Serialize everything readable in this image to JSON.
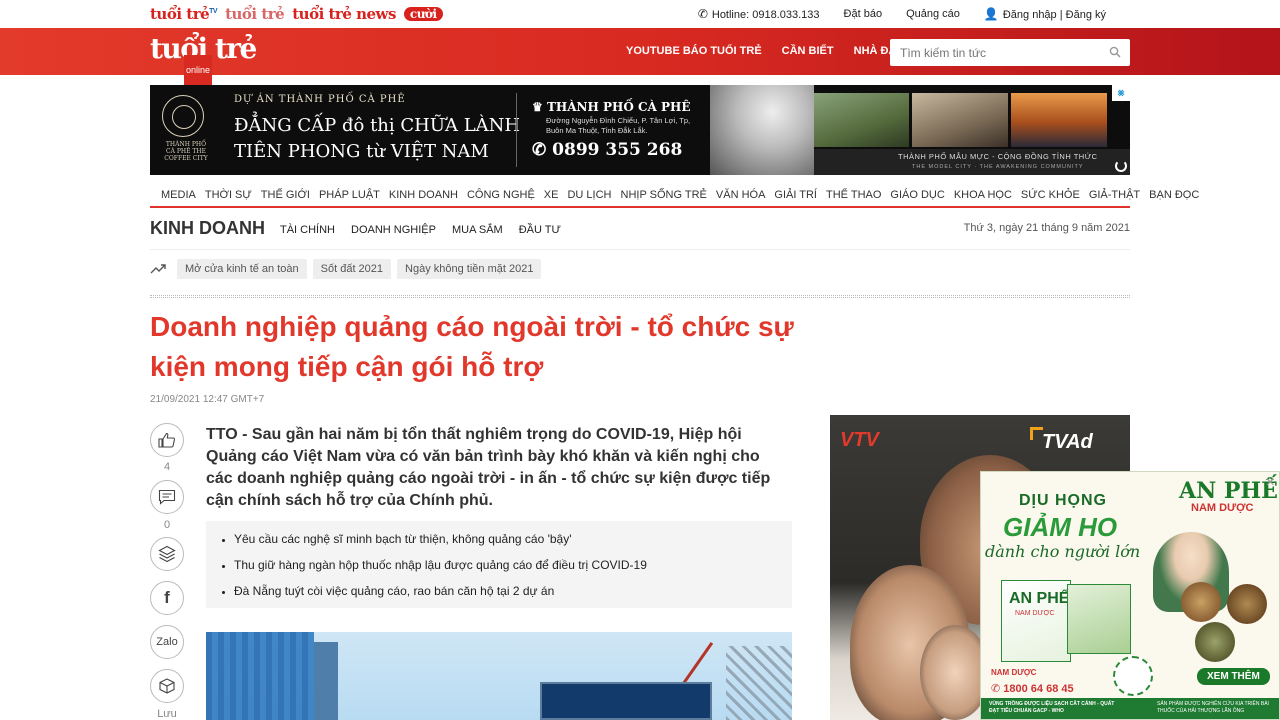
{
  "topbar": {
    "brands": [
      "tuổi trẻ",
      "TV",
      "tuổi trẻ",
      "tuổi trẻ news",
      "cười"
    ],
    "hotline": "Hotline: 0918.033.133",
    "subscribe": "Đặt báo",
    "advertise": "Quảng cáo",
    "login": "Đăng nhập | Đăng ký"
  },
  "header": {
    "logo": "tuổi trẻ",
    "logo_sub": "online",
    "nav": [
      "YOUTUBE BÁO TUỔI TRẺ",
      "CẦN BIẾT",
      "NHÀ ĐẤT"
    ],
    "search_placeholder": "Tìm kiếm tin tức"
  },
  "banner_ad": {
    "emblem_text": "THÀNH PHỐ CÀ PHÊ THE COFFEE CITY",
    "line1": "DỰ ÁN THÀNH PHỐ CÀ PHÊ",
    "line2": "ĐẲNG CẤP đô thị CHỮA LÀNH",
    "line3": "TIÊN PHONG từ VIỆT NAM",
    "brand": "THÀNH PHỐ CÀ PHÊ",
    "address": "Đường Nguyễn Đình Chiểu, P. Tân Lợi, Tp, Buôn Ma Thuột, Tỉnh Đắk Lắk.",
    "phone": "0899 355 268",
    "footer": "THÀNH PHỐ MẪU MỰC - CỘNG ĐỒNG TỈNH THỨC",
    "footer_sub": "THE MODEL CITY · THE AWAKENING COMMUNITY"
  },
  "main_nav": [
    "MEDIA",
    "THỜI SỰ",
    "THẾ GIỚI",
    "PHÁP LUẬT",
    "KINH DOANH",
    "CÔNG NGHỆ",
    "XE",
    "DU LỊCH",
    "NHỊP SỐNG TRẺ",
    "VĂN HÓA",
    "GIẢI TRÍ",
    "THỂ THAO",
    "GIÁO DỤC",
    "KHOA HỌC",
    "SỨC KHỎE",
    "GIẢ-THẬT",
    "BẠN ĐỌC"
  ],
  "section": {
    "title": "KINH DOANH",
    "subnav": [
      "TÀI CHÍNH",
      "DOANH NGHIỆP",
      "MUA SẮM",
      "ĐẦU TƯ"
    ],
    "date": "Thứ 3, ngày 21 tháng 9 năm 2021"
  },
  "tags": [
    "Mở cửa kinh tế an toàn",
    "Sốt đất 2021",
    "Ngày không tiền mặt 2021"
  ],
  "article": {
    "headline": "Doanh nghiệp quảng cáo ngoài trời - tổ chức sự kiện mong tiếp cận gói hỗ trợ",
    "published": "21/09/2021 12:47 GMT+7",
    "sapo": "TTO - Sau gần hai năm bị tổn thất nghiêm trọng do COVID-19, Hiệp hội Quảng cáo Việt Nam vừa có văn bản trình bày khó khăn và kiến nghị cho các doanh nghiệp quảng cáo ngoài trời - in ấn - tổ chức sự kiện được tiếp cận chính sách hỗ trợ của Chính phủ.",
    "related": [
      "Yêu cầu các nghệ sĩ minh bạch từ thiện, không quảng cáo 'bậy'",
      "Thu giữ hàng ngàn hộp thuốc nhập lậu được quảng cáo để điều trị COVID-19",
      "Đà Nẵng tuýt còi việc quảng cáo, rao bán căn hộ tại 2 dự án"
    ]
  },
  "social": {
    "like_count": "4",
    "comment_count": "0",
    "zalo_label": "Zalo",
    "save_label": "Lưu"
  },
  "right_ads": {
    "tv_channel": "VTV",
    "tv_ad": "TVAd",
    "anphe_brand": "AN PHẾ",
    "anphe_sub": "NAM DƯỢC",
    "anphe_l1": "DỊU HỌNG",
    "anphe_l2": "GIẢM HO",
    "anphe_l3": "dành cho người lớn",
    "anphe_box": "AN PHẾ",
    "anphe_box_sub": "NAM DƯỢC",
    "anphe_company": "NAM DƯỢC",
    "anphe_hotline": "1800 64 68 45",
    "anphe_cta": "XEM THÊM",
    "anphe_foot1": "VÙNG TRỒNG ĐƯỢC LIỆU SẠCH CẤT CÁNH - QUẤT ĐẠT TIÊU CHUẨN GACP - WHO",
    "anphe_foot2": "SẢN PHẨM ĐƯỢC NGHIÊN CỨU KIA TRIÊN BÀI THUỐC CỦA HẢI THƯỢNG LÃN ÔNG",
    "close": "×"
  }
}
